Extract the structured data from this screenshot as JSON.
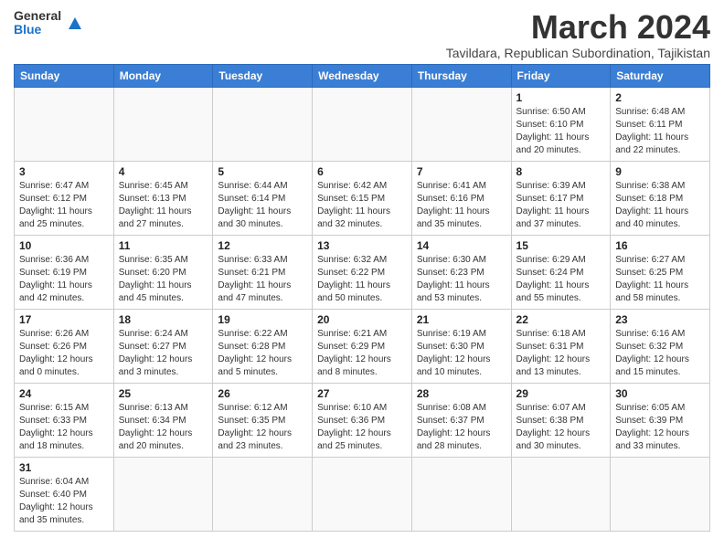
{
  "header": {
    "logo_general": "General",
    "logo_blue": "Blue",
    "month_title": "March 2024",
    "subtitle": "Tavildara, Republican Subordination, Tajikistan"
  },
  "days_of_week": [
    "Sunday",
    "Monday",
    "Tuesday",
    "Wednesday",
    "Thursday",
    "Friday",
    "Saturday"
  ],
  "weeks": [
    [
      {
        "day": "",
        "info": ""
      },
      {
        "day": "",
        "info": ""
      },
      {
        "day": "",
        "info": ""
      },
      {
        "day": "",
        "info": ""
      },
      {
        "day": "",
        "info": ""
      },
      {
        "day": "1",
        "info": "Sunrise: 6:50 AM\nSunset: 6:10 PM\nDaylight: 11 hours and 20 minutes."
      },
      {
        "day": "2",
        "info": "Sunrise: 6:48 AM\nSunset: 6:11 PM\nDaylight: 11 hours and 22 minutes."
      }
    ],
    [
      {
        "day": "3",
        "info": "Sunrise: 6:47 AM\nSunset: 6:12 PM\nDaylight: 11 hours and 25 minutes."
      },
      {
        "day": "4",
        "info": "Sunrise: 6:45 AM\nSunset: 6:13 PM\nDaylight: 11 hours and 27 minutes."
      },
      {
        "day": "5",
        "info": "Sunrise: 6:44 AM\nSunset: 6:14 PM\nDaylight: 11 hours and 30 minutes."
      },
      {
        "day": "6",
        "info": "Sunrise: 6:42 AM\nSunset: 6:15 PM\nDaylight: 11 hours and 32 minutes."
      },
      {
        "day": "7",
        "info": "Sunrise: 6:41 AM\nSunset: 6:16 PM\nDaylight: 11 hours and 35 minutes."
      },
      {
        "day": "8",
        "info": "Sunrise: 6:39 AM\nSunset: 6:17 PM\nDaylight: 11 hours and 37 minutes."
      },
      {
        "day": "9",
        "info": "Sunrise: 6:38 AM\nSunset: 6:18 PM\nDaylight: 11 hours and 40 minutes."
      }
    ],
    [
      {
        "day": "10",
        "info": "Sunrise: 6:36 AM\nSunset: 6:19 PM\nDaylight: 11 hours and 42 minutes."
      },
      {
        "day": "11",
        "info": "Sunrise: 6:35 AM\nSunset: 6:20 PM\nDaylight: 11 hours and 45 minutes."
      },
      {
        "day": "12",
        "info": "Sunrise: 6:33 AM\nSunset: 6:21 PM\nDaylight: 11 hours and 47 minutes."
      },
      {
        "day": "13",
        "info": "Sunrise: 6:32 AM\nSunset: 6:22 PM\nDaylight: 11 hours and 50 minutes."
      },
      {
        "day": "14",
        "info": "Sunrise: 6:30 AM\nSunset: 6:23 PM\nDaylight: 11 hours and 53 minutes."
      },
      {
        "day": "15",
        "info": "Sunrise: 6:29 AM\nSunset: 6:24 PM\nDaylight: 11 hours and 55 minutes."
      },
      {
        "day": "16",
        "info": "Sunrise: 6:27 AM\nSunset: 6:25 PM\nDaylight: 11 hours and 58 minutes."
      }
    ],
    [
      {
        "day": "17",
        "info": "Sunrise: 6:26 AM\nSunset: 6:26 PM\nDaylight: 12 hours and 0 minutes."
      },
      {
        "day": "18",
        "info": "Sunrise: 6:24 AM\nSunset: 6:27 PM\nDaylight: 12 hours and 3 minutes."
      },
      {
        "day": "19",
        "info": "Sunrise: 6:22 AM\nSunset: 6:28 PM\nDaylight: 12 hours and 5 minutes."
      },
      {
        "day": "20",
        "info": "Sunrise: 6:21 AM\nSunset: 6:29 PM\nDaylight: 12 hours and 8 minutes."
      },
      {
        "day": "21",
        "info": "Sunrise: 6:19 AM\nSunset: 6:30 PM\nDaylight: 12 hours and 10 minutes."
      },
      {
        "day": "22",
        "info": "Sunrise: 6:18 AM\nSunset: 6:31 PM\nDaylight: 12 hours and 13 minutes."
      },
      {
        "day": "23",
        "info": "Sunrise: 6:16 AM\nSunset: 6:32 PM\nDaylight: 12 hours and 15 minutes."
      }
    ],
    [
      {
        "day": "24",
        "info": "Sunrise: 6:15 AM\nSunset: 6:33 PM\nDaylight: 12 hours and 18 minutes."
      },
      {
        "day": "25",
        "info": "Sunrise: 6:13 AM\nSunset: 6:34 PM\nDaylight: 12 hours and 20 minutes."
      },
      {
        "day": "26",
        "info": "Sunrise: 6:12 AM\nSunset: 6:35 PM\nDaylight: 12 hours and 23 minutes."
      },
      {
        "day": "27",
        "info": "Sunrise: 6:10 AM\nSunset: 6:36 PM\nDaylight: 12 hours and 25 minutes."
      },
      {
        "day": "28",
        "info": "Sunrise: 6:08 AM\nSunset: 6:37 PM\nDaylight: 12 hours and 28 minutes."
      },
      {
        "day": "29",
        "info": "Sunrise: 6:07 AM\nSunset: 6:38 PM\nDaylight: 12 hours and 30 minutes."
      },
      {
        "day": "30",
        "info": "Sunrise: 6:05 AM\nSunset: 6:39 PM\nDaylight: 12 hours and 33 minutes."
      }
    ],
    [
      {
        "day": "31",
        "info": "Sunrise: 6:04 AM\nSunset: 6:40 PM\nDaylight: 12 hours and 35 minutes."
      },
      {
        "day": "",
        "info": ""
      },
      {
        "day": "",
        "info": ""
      },
      {
        "day": "",
        "info": ""
      },
      {
        "day": "",
        "info": ""
      },
      {
        "day": "",
        "info": ""
      },
      {
        "day": "",
        "info": ""
      }
    ]
  ]
}
